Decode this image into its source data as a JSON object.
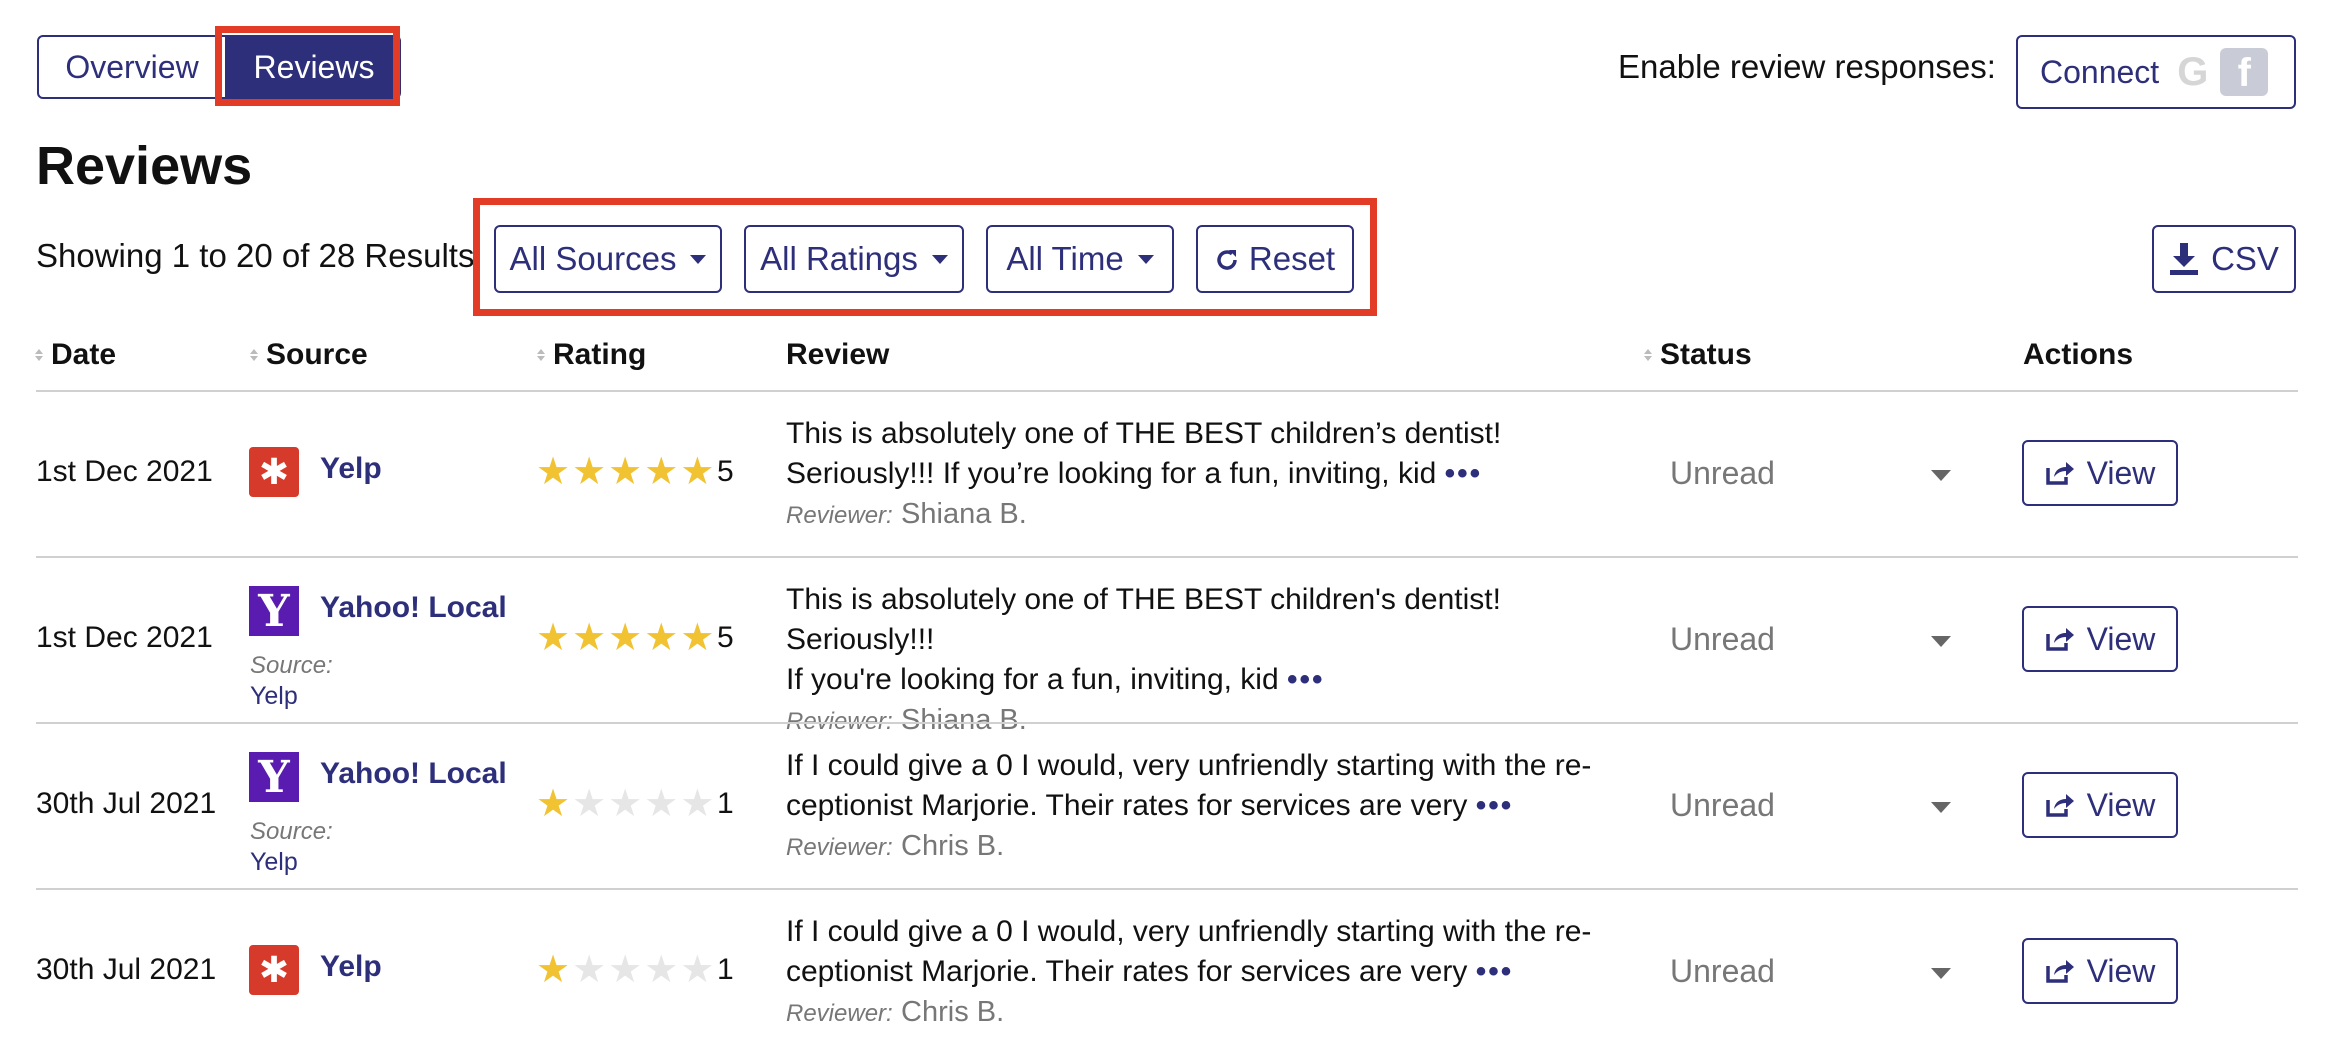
{
  "tabs": [
    {
      "label": "Overview",
      "active": false
    },
    {
      "label": "Reviews",
      "active": true
    }
  ],
  "enable_responses": {
    "label": "Enable review responses:",
    "connect_label": "Connect",
    "google_icon": "google-icon",
    "facebook_icon": "facebook-icon"
  },
  "page_title": "Reviews",
  "results_text": "Showing 1 to 20 of 28 Results",
  "filters": {
    "sources": "All Sources",
    "ratings": "All Ratings",
    "time": "All Time",
    "reset": "Reset"
  },
  "csv_label": "CSV",
  "columns": {
    "date": "Date",
    "source": "Source",
    "rating": "Rating",
    "review": "Review",
    "status": "Status",
    "actions": "Actions"
  },
  "rows": [
    {
      "date": "1st Dec 2021",
      "source": "Yelp",
      "source_icon": "yelp-icon",
      "sub_source_label": "",
      "sub_source": "",
      "rating": 5,
      "rating_text": "5",
      "review_line1": "This is absolutely one of THE BEST children’s dentist!",
      "review_line2": " Seriously!!!   If you’re looking for a fun, inviting, kid",
      "reviewer_label": "Reviewer:",
      "reviewer": "Shiana B.",
      "status": "Unread",
      "action": "View"
    },
    {
      "date": "1st Dec 2021",
      "source": "Yahoo! Local",
      "source_icon": "yahoo-icon",
      "sub_source_label": "Source:",
      "sub_source": "Yelp",
      "rating": 5,
      "rating_text": "5",
      "review_line1": "This is absolutely one of THE BEST children's dentist! Seriously!!!",
      "review_line2": "If you're looking for a fun, inviting, kid",
      "reviewer_label": "Reviewer:",
      "reviewer": "Shiana B.",
      "status": "Unread",
      "action": "View"
    },
    {
      "date": "30th Jul 2021",
      "source": "Yahoo! Local",
      "source_icon": "yahoo-icon",
      "sub_source_label": "Source:",
      "sub_source": "Yelp",
      "rating": 1,
      "rating_text": "1",
      "review_line1": "If I could give a 0 I would, very unfriendly starting with the re-",
      "review_line2": "ceptionist Marjorie. Their rates for services are very",
      "reviewer_label": "Reviewer:",
      "reviewer": "Chris B.",
      "status": "Unread",
      "action": "View"
    },
    {
      "date": "30th Jul 2021",
      "source": "Yelp",
      "source_icon": "yelp-icon",
      "sub_source_label": "",
      "sub_source": "",
      "rating": 1,
      "rating_text": "1",
      "review_line1": "If I could give a 0 I would, very unfriendly starting with the re-",
      "review_line2": "ceptionist Marjorie. Their rates for services are very",
      "reviewer_label": "Reviewer:",
      "reviewer": "Chris B.",
      "status": "Unread",
      "action": "View"
    }
  ],
  "colors": {
    "accent": "#2e2f7a",
    "highlight": "#e23b26",
    "star": "#f1c232",
    "yelp": "#d63a2a",
    "yahoo": "#5a1bb0"
  }
}
